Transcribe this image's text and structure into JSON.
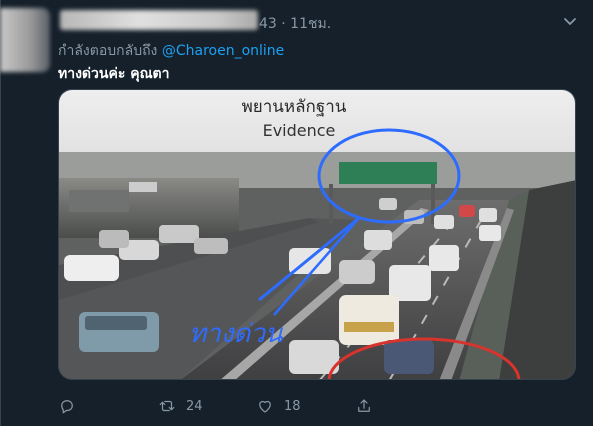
{
  "tweet": {
    "meta_time": "43 · 11ชม.",
    "reply_prefix": "กำลังตอบกลับถึง",
    "reply_handle": "@Charoen_online",
    "text": "ทางด่วนค่ะ คุณตา"
  },
  "image": {
    "caption_thai": "พยานหลักฐาน",
    "caption_en": "Evidence",
    "handwritten": "ทางด่วน"
  },
  "actions": {
    "reply_icon": "reply-icon",
    "retweet_count": "24",
    "like_count": "18",
    "share_icon": "share-icon"
  },
  "colors": {
    "background": "#15202b",
    "link": "#1da1f2",
    "secondary_text": "#8899a6",
    "annotation_blue": "#2e6cff",
    "annotation_red": "#d8332d"
  }
}
